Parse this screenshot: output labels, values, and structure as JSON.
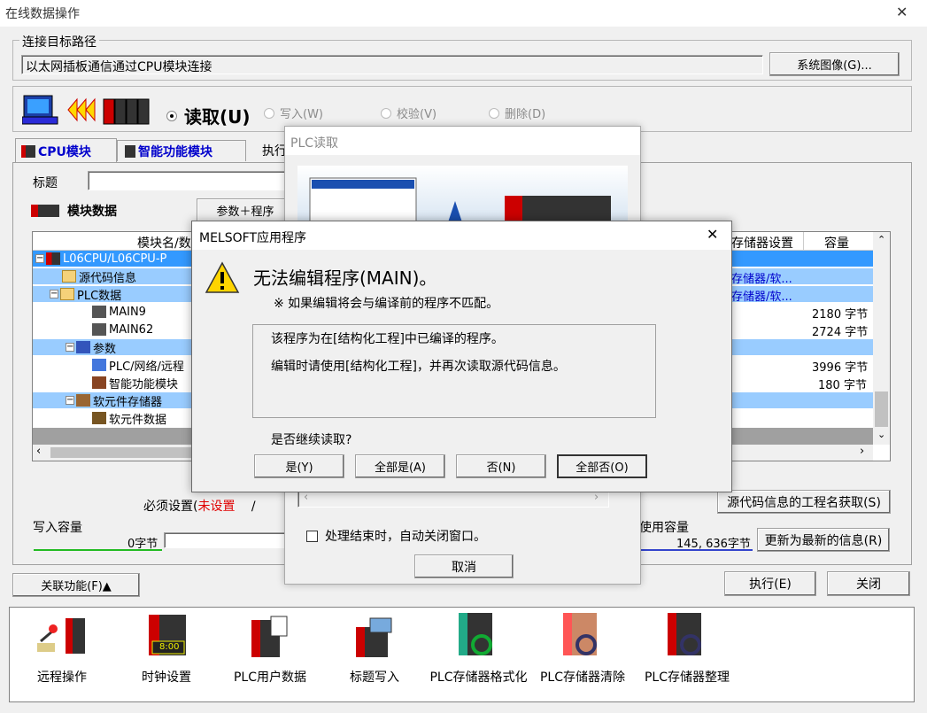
{
  "window": {
    "title": "在线数据操作",
    "close_glyph": "✕"
  },
  "route": {
    "group_label": "连接目标路径",
    "path_text": "以太网插板通信通过CPU模块连接",
    "system_image_button": "系统图像(G)..."
  },
  "mode": {
    "read": "读取(U)",
    "write": "写入(W)",
    "verify": "校验(V)",
    "delete": "删除(D)"
  },
  "tabs": {
    "cpu": "CPU模块",
    "intelligent": "智能功能模块",
    "exec": "执行"
  },
  "title_label": "标题",
  "module_data": {
    "label": "模块数据",
    "param_program_button": "参数＋程序",
    "col_module_name": "模块名/数",
    "col_storage": "存储器设置",
    "col_capacity": "容量",
    "rows": [
      {
        "name": "L06CPU/L06CPU-P",
        "storage": "",
        "capacity": ""
      },
      {
        "name": "源代码信息",
        "storage": "存储器/软...",
        "capacity": ""
      },
      {
        "name": "PLC数据",
        "storage": "存储器/软...",
        "capacity": ""
      },
      {
        "name": "MAIN9",
        "storage": "",
        "capacity": "2180 字节"
      },
      {
        "name": "MAIN62",
        "storage": "",
        "capacity": "2724 字节"
      },
      {
        "name": "参数",
        "storage": "",
        "capacity": ""
      },
      {
        "name": "PLC/网络/远程",
        "storage": "",
        "capacity": "3996 字节"
      },
      {
        "name": "智能功能模块",
        "storage": "",
        "capacity": "180 字节"
      },
      {
        "name": "软元件存储器",
        "storage": "",
        "capacity": ""
      },
      {
        "name": "软元件数据",
        "storage": "",
        "capacity": ""
      }
    ]
  },
  "required": {
    "label": "必须设置(",
    "status": "未设置",
    "sep": "/"
  },
  "capacity": {
    "write_label": "写入容量",
    "write_value": "0字节",
    "used_label": "使用容量",
    "used_value": "145, 636字节"
  },
  "buttons": {
    "source_info": "源代码信息的工程名获取(S)",
    "refresh": "更新为最新的信息(R)",
    "related": "关联功能(F)▲",
    "execute": "执行(E)",
    "close": "关闭"
  },
  "tools": [
    {
      "label": "远程操作",
      "icon": "remote-operation-icon"
    },
    {
      "label": "时钟设置",
      "icon": "clock-setting-icon",
      "display": "8:00"
    },
    {
      "label": "PLC用户数据",
      "icon": "plc-user-data-icon"
    },
    {
      "label": "标题写入",
      "icon": "title-write-icon"
    },
    {
      "label": "PLC存储器格式化",
      "icon": "plc-memory-format-icon"
    },
    {
      "label": "PLC存储器清除",
      "icon": "plc-memory-clear-icon"
    },
    {
      "label": "PLC存储器整理",
      "icon": "plc-memory-arrange-icon"
    }
  ],
  "plc_read_dialog": {
    "title": "PLC读取",
    "auto_close_label": "处理结束时，自动关闭窗口。",
    "cancel": "取消"
  },
  "msg_dialog": {
    "title": "MELSOFT应用程序",
    "close_glyph": "✕",
    "headline": "无法编辑程序(MAIN)。",
    "note": "※ 如果编辑将会与编译前的程序不匹配。",
    "detail_line1": "该程序为在[结构化工程]中已编译的程序。",
    "detail_line2": "编辑时请使用[结构化工程]，并再次读取源代码信息。",
    "question": "是否继续读取?",
    "yes": "是(Y)",
    "yes_all": "全部是(A)",
    "no": "否(N)",
    "no_all": "全部否(O)"
  },
  "colors": {
    "selected_row": "#3399ff",
    "highlight_row": "#99ccff",
    "link_blue": "#0000cc",
    "error_red": "#e00000"
  }
}
